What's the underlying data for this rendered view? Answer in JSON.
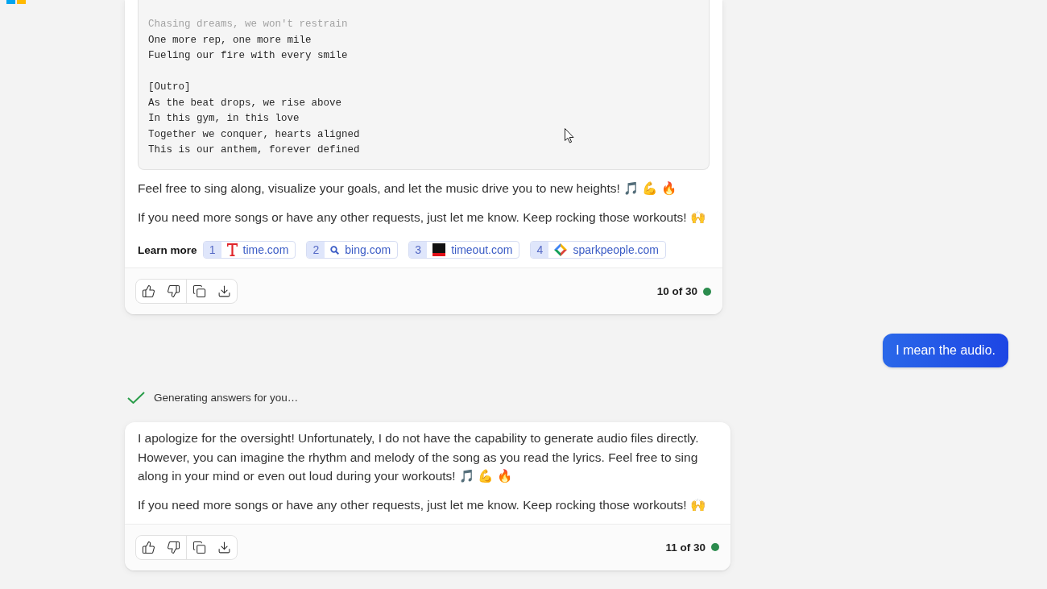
{
  "conversation": [
    {
      "kind": "bot",
      "code_block": {
        "stanzas": [
          [
            "Chasing dreams, we won't restrain",
            "One more rep, one more mile",
            "Fueling our fire with every smile"
          ],
          [
            "[Outro]",
            "As the beat drops, we rise above",
            "In this gym, in this love",
            "Together we conquer, hearts aligned",
            "This is our anthem, forever defined"
          ]
        ]
      },
      "paragraphs": [
        "Feel free to sing along, visualize your goals, and let the music drive you to new heights! 🎵 💪 🔥",
        "If you need more songs or have any other requests, just let me know. Keep rocking those workouts! 🙌"
      ],
      "learn_more": {
        "label": "Learn more",
        "sources": [
          {
            "number": "1",
            "domain": "time.com"
          },
          {
            "number": "2",
            "domain": "bing.com"
          },
          {
            "number": "3",
            "domain": "timeout.com"
          },
          {
            "number": "4",
            "domain": "sparkpeople.com"
          }
        ]
      },
      "counter": "10 of 30"
    },
    {
      "kind": "user",
      "text": "I mean the audio."
    },
    {
      "kind": "status",
      "text": "Generating answers for you…",
      "done": true
    },
    {
      "kind": "bot",
      "paragraphs": [
        "I apologize for the oversight! Unfortunately, I do not have the capability to generate audio files directly. However, you can imagine the rhythm and melody of the song as you read the lyrics. Feel free to sing along in your mind or even out loud during your workouts! 🎵 💪 🔥",
        "If you need more songs or have any other requests, just let me know. Keep rocking those workouts! 🙌"
      ],
      "counter": "11 of 30"
    }
  ]
}
